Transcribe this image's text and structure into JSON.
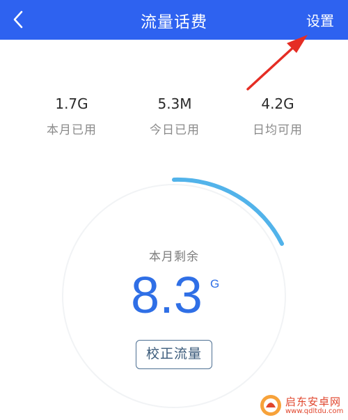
{
  "header": {
    "title": "流量话费",
    "settings_label": "设置",
    "background_color": "#2e62f0"
  },
  "icons": {
    "back": "chevron-left-icon",
    "annotation": "red-arrow-icon"
  },
  "stats": [
    {
      "value": "1.7G",
      "label": "本月已用"
    },
    {
      "value": "5.3M",
      "label": "今日已用"
    },
    {
      "value": "4.2G",
      "label": "日均可用"
    }
  ],
  "gauge": {
    "label": "本月剩余",
    "value": "8.3",
    "unit": "G",
    "accent_color": "#52b3ea",
    "value_color": "#2f6fe6"
  },
  "calibrate_button": {
    "label": "校正流量"
  },
  "watermark": {
    "name": "启东安卓网",
    "url": "www.qdltdu.com"
  }
}
